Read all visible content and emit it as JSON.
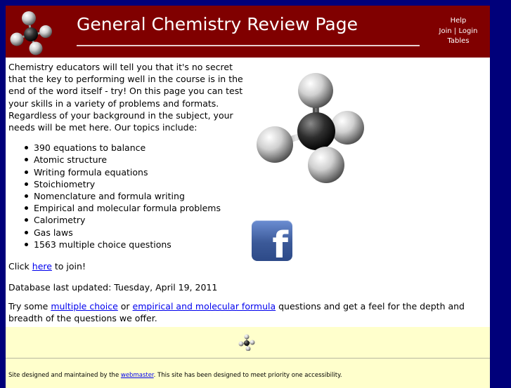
{
  "header": {
    "title": "General Chemistry Review Page",
    "nav": {
      "help": "Help",
      "join": "Join",
      "separator": "|",
      "login": "Login",
      "tables": "Tables"
    },
    "colors": {
      "banner": "#800000",
      "page_border": "#00007a"
    }
  },
  "main": {
    "intro": "Chemistry educators will tell you that it's no secret that the key to performing well in the course is in the end of the word itself - try!  On this page you can test your skills in a variety of problems and formats.  Regardless of your background in the subject, your needs will be met here.  Our topics include:",
    "topics": [
      "390 equations to balance",
      "Atomic structure",
      "Writing formula equations",
      "Stoichiometry",
      "Nomenclature and formula writing",
      "Empirical and molecular formula problems",
      "Calorimetry",
      "Gas laws",
      "1563 multiple choice questions"
    ],
    "join_prefix": "Click ",
    "join_link": "here",
    "join_suffix": " to join!",
    "updated": "Database last updated: Tuesday, April 19, 2011",
    "try_prefix": "Try some ",
    "try_link1": "multiple choice",
    "try_mid": " or ",
    "try_link2": "empirical and molecular formula",
    "try_suffix": " questions and get a feel for the depth and breadth of the questions we offer."
  },
  "images": {
    "logo": "methane-molecule-icon",
    "main": "methane-molecule-model",
    "social": "facebook-icon",
    "social_letter": "f"
  },
  "footer": {
    "prefix": "Site designed and maintained by the ",
    "link": "webmaster",
    "suffix": ".  This site has been designed to meet priority one accessibility.",
    "colors": {
      "background": "#ffffcc"
    }
  }
}
